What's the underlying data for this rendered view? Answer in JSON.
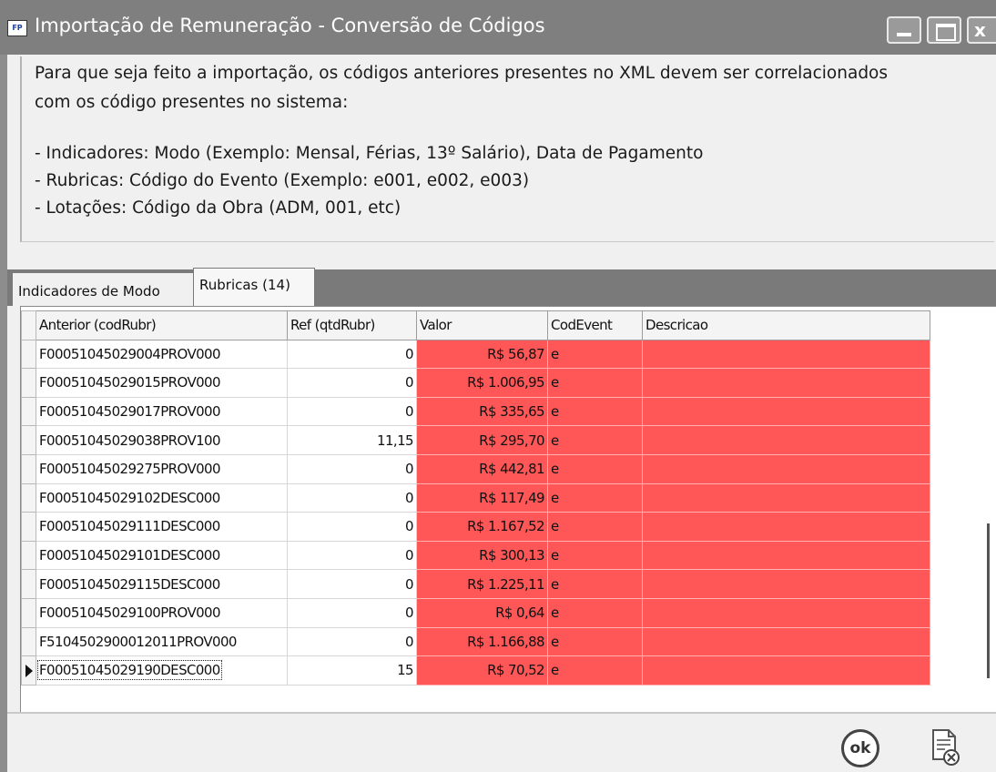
{
  "window": {
    "title": "Importação de Remuneração - Conversão de Códigos",
    "app_icon_text": "FP"
  },
  "info": {
    "line1": "Para que seja feito a importação, os códigos anteriores presentes no XML devem ser correlacionados",
    "line2": "com os código presentes no sistema:",
    "line3": "- Indicadores: Modo (Exemplo: Mensal, Férias, 13º Salário), Data de Pagamento",
    "line4": "- Rubricas: Código do Evento (Exemplo: e001, e002, e003)",
    "line5": "- Lotações: Código da Obra (ADM, 001, etc)"
  },
  "tabs": [
    {
      "label": "Indicadores de Modo",
      "active": false
    },
    {
      "label": "Rubricas (14)",
      "active": true
    }
  ],
  "grid": {
    "columns": [
      "Anterior (codRubr)",
      "Ref (qtdRubr)",
      "Valor",
      "CodEvent",
      "Descricao"
    ],
    "rows": [
      {
        "anterior": "F00051045029004PROV000",
        "ref": "0",
        "valor": "R$ 56,87",
        "codevent": "e",
        "descricao": ""
      },
      {
        "anterior": "F00051045029015PROV000",
        "ref": "0",
        "valor": "R$ 1.006,95",
        "codevent": "e",
        "descricao": ""
      },
      {
        "anterior": "F00051045029017PROV000",
        "ref": "0",
        "valor": "R$ 335,65",
        "codevent": "e",
        "descricao": ""
      },
      {
        "anterior": "F00051045029038PROV100",
        "ref": "11,15",
        "valor": "R$ 295,70",
        "codevent": "e",
        "descricao": ""
      },
      {
        "anterior": "F00051045029275PROV000",
        "ref": "0",
        "valor": "R$ 442,81",
        "codevent": "e",
        "descricao": ""
      },
      {
        "anterior": "F00051045029102DESC000",
        "ref": "0",
        "valor": "R$ 117,49",
        "codevent": "e",
        "descricao": ""
      },
      {
        "anterior": "F00051045029111DESC000",
        "ref": "0",
        "valor": "R$ 1.167,52",
        "codevent": "e",
        "descricao": ""
      },
      {
        "anterior": "F00051045029101DESC000",
        "ref": "0",
        "valor": "R$ 300,13",
        "codevent": "e",
        "descricao": ""
      },
      {
        "anterior": "F00051045029115DESC000",
        "ref": "0",
        "valor": "R$ 1.225,11",
        "codevent": "e",
        "descricao": ""
      },
      {
        "anterior": "F00051045029100PROV000",
        "ref": "0",
        "valor": "R$ 0,64",
        "codevent": "e",
        "descricao": ""
      },
      {
        "anterior": "F5104502900012011PROV000",
        "ref": "0",
        "valor": "R$ 1.166,88",
        "codevent": "e",
        "descricao": ""
      },
      {
        "anterior": "F00051045029190DESC000",
        "ref": "15",
        "valor": "R$ 70,52",
        "codevent": "e",
        "descricao": ""
      }
    ],
    "current_row_index": 11
  },
  "footer": {
    "ok_label": "ok",
    "cancel_icon": "document-cancel-icon"
  },
  "colors": {
    "invalid_cell": "#ff5757",
    "titlebar": "#7f7f7f"
  }
}
